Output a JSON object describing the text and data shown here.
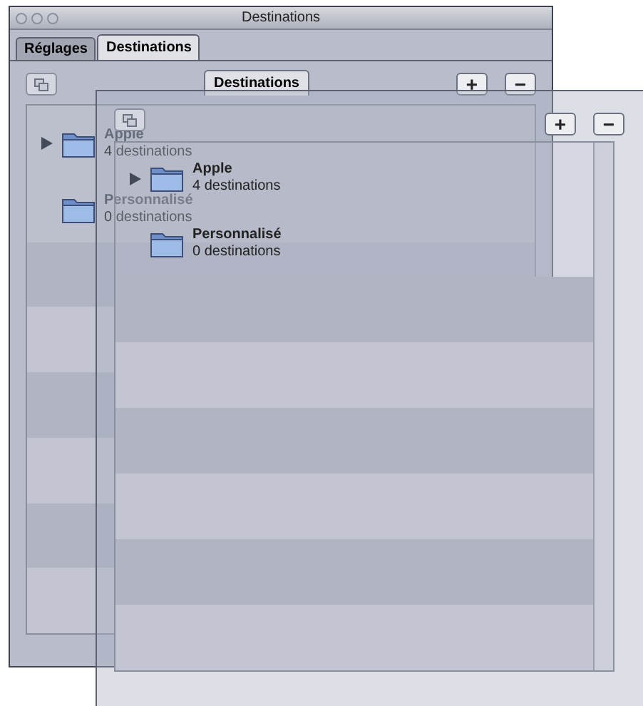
{
  "window": {
    "title": "Destinations",
    "tabs": [
      {
        "label": "Réglages",
        "selected": false
      },
      {
        "label": "Destinations",
        "selected": true
      }
    ]
  },
  "destinations_panel": {
    "tab_label": "Destinations",
    "buttons": [
      "+",
      "−"
    ],
    "items": [
      {
        "name": "Apple",
        "count": "4 destinations",
        "expandable": true
      },
      {
        "name": "Personnalisé",
        "count": "0 destinations",
        "expandable": false
      }
    ]
  },
  "floating_panel": {
    "buttons": [
      "+",
      "−"
    ],
    "items": [
      {
        "name": "Apple",
        "count": "4 destinations",
        "expandable": true
      },
      {
        "name": "Personnalisé",
        "count": "0 destinations",
        "expandable": false
      }
    ]
  }
}
